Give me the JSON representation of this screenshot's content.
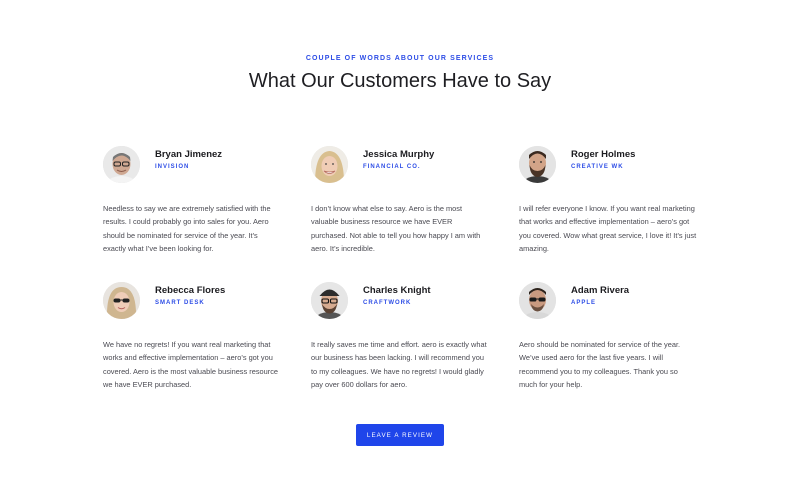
{
  "header": {
    "eyebrow": "COUPLE OF WORDS ABOUT OUR SERVICES",
    "title": "What Our Customers Have to Say"
  },
  "testimonials": [
    {
      "name": "Bryan Jimenez",
      "company": "INVISION",
      "quote": "Needless to say we are extremely satisfied with the results. I could probably go into sales for you. Aero should be nominated for service of the year. It’s exactly what I’ve been looking for.",
      "avatar_icon": "man-glasses-portrait-icon"
    },
    {
      "name": "Jessica Murphy",
      "company": "FINANCIAL CO.",
      "quote": "I don’t know what else to say. Aero is the most valuable business resource we have EVER purchased. Not able to tell you how happy I am with aero. It’s incredible.",
      "avatar_icon": "woman-blonde-portrait-icon"
    },
    {
      "name": "Roger Holmes",
      "company": "CREATIVE WK",
      "quote": "I will refer everyone I know. If you want real marketing that works and effective implementation – aero’s got you covered. Wow what great service, I love it! It’s just amazing.",
      "avatar_icon": "man-beard-portrait-icon"
    },
    {
      "name": "Rebecca Flores",
      "company": "SMART DESK",
      "quote": "We have no regrets! If you want real marketing that works and effective implementation – aero’s got you covered. Aero is the most valuable business resource we have EVER purchased.",
      "avatar_icon": "woman-sunglasses-portrait-icon"
    },
    {
      "name": "Charles Knight",
      "company": "CRAFTWORK",
      "quote": "It really saves me time and effort. aero is exactly what our business has been lacking. I will recommend you to my colleagues. We have no regrets! I would gladly pay over 600 dollars for aero.",
      "avatar_icon": "man-cap-glasses-portrait-icon"
    },
    {
      "name": "Adam Rivera",
      "company": "APPLE",
      "quote": "Aero should be nominated for service of the year. We’ve used aero for the last five years. I will recommend you to my colleagues. Thank you so much for your help.",
      "avatar_icon": "man-sunglasses-portrait-icon"
    }
  ],
  "cta": {
    "label": "LEAVE A REVIEW",
    "color": "#1f45ea"
  },
  "colors": {
    "accent": "#2d4de6",
    "heading": "#1e1e22",
    "body_text": "#4a4a52"
  }
}
